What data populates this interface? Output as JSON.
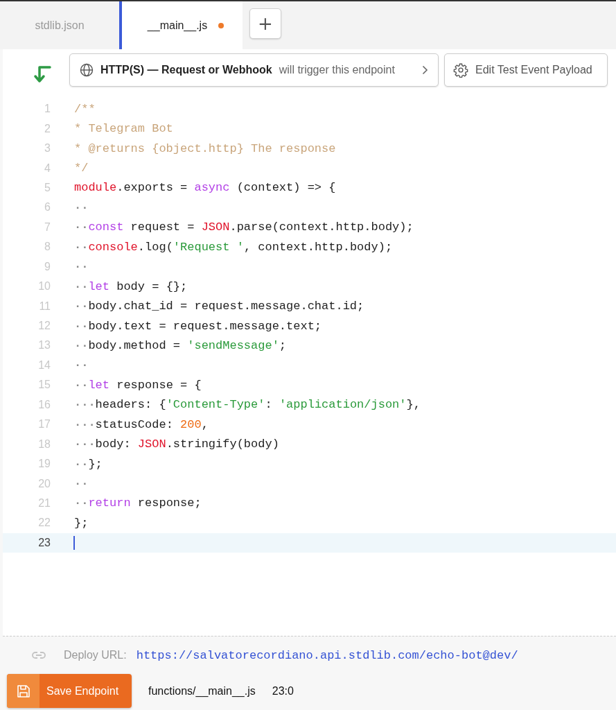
{
  "tabs": [
    {
      "label": "stdlib.json",
      "selected": false,
      "modified": false
    },
    {
      "label": "__main__.js",
      "selected": true,
      "modified": true
    }
  ],
  "add_tab": "+",
  "trigger": {
    "name": "HTTP(S) — Request or Webhook",
    "suffix": "will trigger this endpoint"
  },
  "edit_payload_button": "Edit Test Event Payload",
  "code_lines": [
    {
      "number": "1",
      "active": false,
      "tokens": [
        {
          "kind": "comment",
          "text": "/**"
        }
      ]
    },
    {
      "number": "2",
      "active": false,
      "tokens": [
        {
          "kind": "comment",
          "text": "* Telegram Bot"
        }
      ]
    },
    {
      "number": "3",
      "active": false,
      "tokens": [
        {
          "kind": "comment",
          "text": "* @returns {object.http} The response"
        }
      ]
    },
    {
      "number": "4",
      "active": false,
      "tokens": [
        {
          "kind": "comment",
          "text": "*/"
        }
      ]
    },
    {
      "number": "5",
      "active": false,
      "tokens": [
        {
          "kind": "ident",
          "text": "module"
        },
        {
          "kind": "plain",
          "text": ".exports = "
        },
        {
          "kind": "keyword",
          "text": "async"
        },
        {
          "kind": "plain",
          "text": " (context) => {"
        }
      ]
    },
    {
      "number": "6",
      "active": false,
      "tokens": [
        {
          "kind": "space",
          "text": "··"
        }
      ]
    },
    {
      "number": "7",
      "active": false,
      "tokens": [
        {
          "kind": "space",
          "text": "··"
        },
        {
          "kind": "keyword",
          "text": "const"
        },
        {
          "kind": "plain",
          "text": " request = "
        },
        {
          "kind": "ident",
          "text": "JSON"
        },
        {
          "kind": "plain",
          "text": ".parse(context.http.body);"
        }
      ]
    },
    {
      "number": "8",
      "active": false,
      "tokens": [
        {
          "kind": "space",
          "text": "··"
        },
        {
          "kind": "ident",
          "text": "console"
        },
        {
          "kind": "plain",
          "text": ".log("
        },
        {
          "kind": "string",
          "text": "'Request '"
        },
        {
          "kind": "plain",
          "text": ", context.http.body);"
        }
      ]
    },
    {
      "number": "9",
      "active": false,
      "tokens": [
        {
          "kind": "space",
          "text": "··"
        }
      ]
    },
    {
      "number": "10",
      "active": false,
      "tokens": [
        {
          "kind": "space",
          "text": "··"
        },
        {
          "kind": "keyword",
          "text": "let"
        },
        {
          "kind": "plain",
          "text": " body = {};"
        }
      ]
    },
    {
      "number": "11",
      "active": false,
      "tokens": [
        {
          "kind": "space",
          "text": "··"
        },
        {
          "kind": "plain",
          "text": "body.chat_id = request.message.chat.id;"
        }
      ]
    },
    {
      "number": "12",
      "active": false,
      "tokens": [
        {
          "kind": "space",
          "text": "··"
        },
        {
          "kind": "plain",
          "text": "body.text = request.message.text;"
        }
      ]
    },
    {
      "number": "13",
      "active": false,
      "tokens": [
        {
          "kind": "space",
          "text": "··"
        },
        {
          "kind": "plain",
          "text": "body.method = "
        },
        {
          "kind": "string",
          "text": "'sendMessage'"
        },
        {
          "kind": "plain",
          "text": ";"
        }
      ]
    },
    {
      "number": "14",
      "active": false,
      "tokens": [
        {
          "kind": "space",
          "text": "··"
        }
      ]
    },
    {
      "number": "15",
      "active": false,
      "tokens": [
        {
          "kind": "space",
          "text": "··"
        },
        {
          "kind": "keyword",
          "text": "let"
        },
        {
          "kind": "plain",
          "text": " response = {"
        }
      ]
    },
    {
      "number": "16",
      "active": false,
      "tokens": [
        {
          "kind": "space",
          "text": "···"
        },
        {
          "kind": "plain",
          "text": "headers: {"
        },
        {
          "kind": "string",
          "text": "'Content-Type'"
        },
        {
          "kind": "plain",
          "text": ": "
        },
        {
          "kind": "string",
          "text": "'application/json'"
        },
        {
          "kind": "plain",
          "text": "},"
        }
      ]
    },
    {
      "number": "17",
      "active": false,
      "tokens": [
        {
          "kind": "space",
          "text": "···"
        },
        {
          "kind": "plain",
          "text": "statusCode: "
        },
        {
          "kind": "number",
          "text": "200"
        },
        {
          "kind": "plain",
          "text": ","
        }
      ]
    },
    {
      "number": "18",
      "active": false,
      "tokens": [
        {
          "kind": "space",
          "text": "···"
        },
        {
          "kind": "plain",
          "text": "body: "
        },
        {
          "kind": "ident",
          "text": "JSON"
        },
        {
          "kind": "plain",
          "text": ".stringify(body)"
        }
      ]
    },
    {
      "number": "19",
      "active": false,
      "tokens": [
        {
          "kind": "space",
          "text": "··"
        },
        {
          "kind": "plain",
          "text": "};"
        }
      ]
    },
    {
      "number": "20",
      "active": false,
      "tokens": [
        {
          "kind": "space",
          "text": "··"
        }
      ]
    },
    {
      "number": "21",
      "active": false,
      "tokens": [
        {
          "kind": "space",
          "text": "··"
        },
        {
          "kind": "keyword",
          "text": "return"
        },
        {
          "kind": "plain",
          "text": " response;"
        }
      ]
    },
    {
      "number": "22",
      "active": false,
      "tokens": [
        {
          "kind": "plain",
          "text": "};"
        }
      ]
    },
    {
      "number": "23",
      "active": true
    }
  ],
  "deploy": {
    "label": "Deploy URL:",
    "url": "https://salvatorecordiano.api.stdlib.com/echo-bot@dev/"
  },
  "status_bar": {
    "save_button": "Save Endpoint",
    "file_path": "functions/__main__.js",
    "cursor_position": "23:0"
  }
}
